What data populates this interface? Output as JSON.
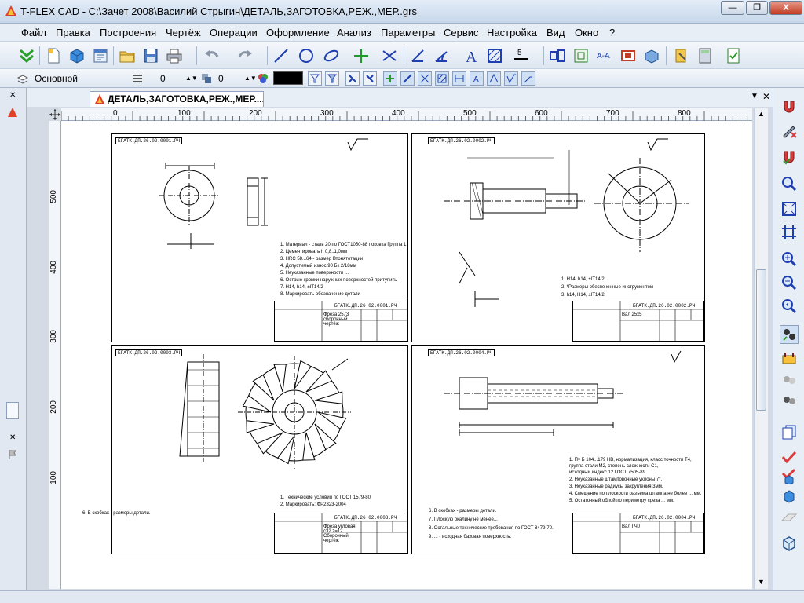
{
  "window": {
    "title": "T-FLEX CAD - C:\\Зачет 2008\\Василий Стрыгин\\ДЕТАЛЬ,ЗАГОТОВКА,РЕЖ.,МЕР..grs",
    "minimize": "—",
    "restore": "❐",
    "close": "X"
  },
  "menu": [
    "Файл",
    "Правка",
    "Построения",
    "Чертёж",
    "Операции",
    "Оформление",
    "Анализ",
    "Параметры",
    "Сервис",
    "Настройка",
    "Вид",
    "Окно",
    "?"
  ],
  "toolbar2": {
    "layer": "Основной",
    "level": "0",
    "priority": "0",
    "step_value": "5"
  },
  "document": {
    "tab_title": "ДЕТАЛЬ,ЗАГОТОВКА,РЕЖ.,МЕР....."
  },
  "ruler": {
    "h_ticks": [
      "0",
      "100",
      "200",
      "300",
      "400",
      "500",
      "600",
      "700",
      "800"
    ],
    "v_ticks": [
      "500",
      "400",
      "300",
      "200",
      "100"
    ]
  },
  "sheets": [
    {
      "code": "БГАТК.ДП.26.02.0001.РЧ",
      "stamp_code": "БГАТК.ДП.26.02.0001.РЧ",
      "stamp_name": "Фреза 2573 сборочный чертёж",
      "notes": [
        "1. Материал - сталь 20 по ГОСТ1050-88 поковка Группа 1.",
        "2. Цементировать h 0,8..1,0мм",
        "3. HRC 58...64 - размер Втонятотации",
        "4. Допустимый износ 90 Бк 2/18мм",
        "5. Неуказанные поверхности ...",
        "6. Острые кромки наружных поверхностей притупить",
        "7. H14, h14, ±IT14/2",
        "8. Маркировать    обозначение детали"
      ]
    },
    {
      "code": "БГАТК.ДП.26.02.0002.РЧ",
      "stamp_code": "БГАТК.ДП.26.02.0002.РЧ",
      "stamp_name": "Вал 25х5",
      "notes": [
        "1. H14, h14, ±IT14/2",
        "2. *Размеры обеспеченные инструментом",
        "3. h14, H14, ±IT14/2"
      ]
    },
    {
      "code": "БГАТК.ДП.26.02.0003.РЧ",
      "stamp_code": "БГАТК.ДП.26.02.0003.РЧ",
      "stamp_name": "Фреза угловая с32 z=12 Сборочный чертёж",
      "notes": [
        "1. Технические условия по ГОСТ 1579-80",
        "2. Маркировать: ФР2323-2004"
      ]
    },
    {
      "code": "БГАТК.ДП.26.02.0004.РЧ",
      "stamp_code": "БГАТК.ДП.26.02.0004.РЧ",
      "stamp_name": "Вал ГЧ0",
      "notes": [
        "1. Пу Б 104...179 HB, нормализация, класс точности Т4,",
        "группа стали М2, степень сложности С1,",
        "исходный индекс 12 ГОСТ 7505-89.",
        "2. Неуказанные штамповочные уклоны 7°.",
        "3. Неуказанные радиусы закругления 3мм.",
        "4. Смещение по плоскости разъема штампа не более ... мм.",
        "5. Остаточный облой по периметру среза ... мм."
      ],
      "left_notes": [
        "6. В скобках - размеры детали.",
        "7. Плоскую окалину не менее...",
        "8. Остальные технические требования по ГОСТ 8479-70.",
        "9. ... - исходная базовая поверхность."
      ]
    }
  ],
  "colors": {
    "window_bg": "#d4dbe5",
    "menubar": "#e8eef6",
    "canvas": "#ffffff",
    "accent": "#1f5fa8"
  }
}
